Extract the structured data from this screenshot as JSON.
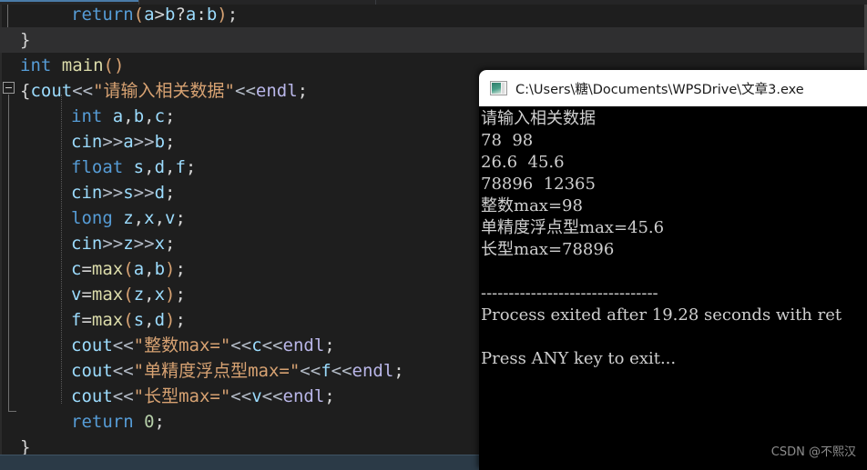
{
  "editor": {
    "name": "code-editor",
    "theme_bg": "#1e1e1e",
    "highlight_line_bg": "#2f2f30",
    "lines": [
      {
        "indent": 1,
        "text": "return(a>b?a:b);"
      },
      {
        "indent": 0,
        "text": "}"
      },
      {
        "indent": 0,
        "text": "int main()"
      },
      {
        "indent": 0,
        "text": "{cout<<\"请输入相关数据\"<<endl;"
      },
      {
        "indent": 1,
        "text": "int a,b,c;"
      },
      {
        "indent": 1,
        "text": "cin>>a>>b;"
      },
      {
        "indent": 1,
        "text": "float s,d,f;"
      },
      {
        "indent": 1,
        "text": "cin>>s>>d;"
      },
      {
        "indent": 1,
        "text": "long z,x,v;"
      },
      {
        "indent": 1,
        "text": "cin>>z>>x;"
      },
      {
        "indent": 1,
        "text": "c=max(a,b);"
      },
      {
        "indent": 1,
        "text": "v=max(z,x);"
      },
      {
        "indent": 1,
        "text": "f=max(s,d);"
      },
      {
        "indent": 1,
        "text": "cout<<\"整数max=\"<<c<<endl;"
      },
      {
        "indent": 1,
        "text": "cout<<\"单精度浮点型max=\"<<f<<endl;"
      },
      {
        "indent": 1,
        "text": "cout<<\"长型max=\"<<v<<endl;"
      },
      {
        "indent": 1,
        "text": "return 0;"
      },
      {
        "indent": 0,
        "text": "}"
      }
    ]
  },
  "console": {
    "window_name": "program-console-window",
    "title": "C:\\Users\\糖\\Documents\\WPSDrive\\文章3.exe",
    "icon": "console-app-icon",
    "output": [
      "请输入相关数据",
      "78  98",
      "26.6  45.6",
      "78896  12365",
      "整数max=98",
      "单精度浮点型max=45.6",
      "长型max=78896",
      "",
      "--------------------------------",
      "Process exited after 19.28 seconds with ret",
      "",
      "Press ANY key to exit..."
    ]
  },
  "watermark": {
    "text": "CSDN @不熙汉"
  }
}
